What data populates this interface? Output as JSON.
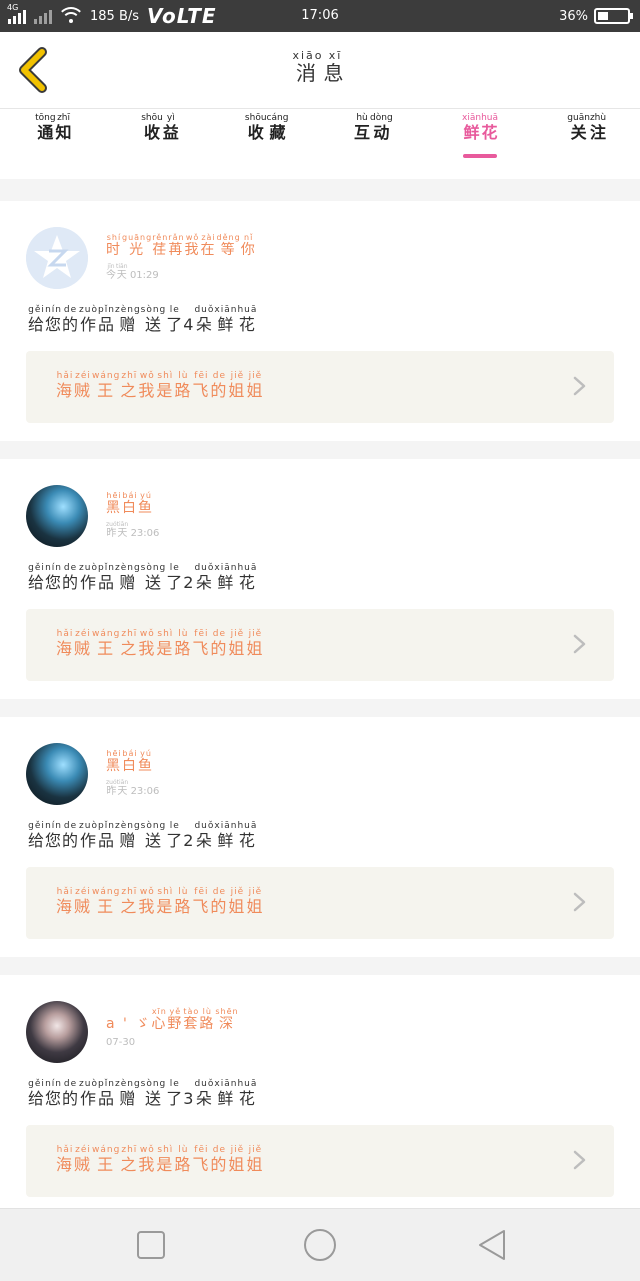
{
  "status_bar": {
    "network_label": "4G",
    "speed": "185 B/s",
    "volte": "VoLTE",
    "time": "17:06",
    "battery": "36%",
    "battery_level": 0.36
  },
  "header": {
    "title_pinyin": [
      "xiāo",
      "xī"
    ],
    "title_chars": [
      "消",
      "息"
    ]
  },
  "tabs": [
    {
      "chars": [
        "通",
        "知"
      ],
      "pinyin": [
        "tōng",
        "zhī"
      ],
      "active": false
    },
    {
      "chars": [
        "收",
        "益"
      ],
      "pinyin": [
        "shōu",
        "yì"
      ],
      "active": false
    },
    {
      "chars": [
        "收",
        "藏"
      ],
      "pinyin": [
        "shōu",
        "cáng"
      ],
      "active": false
    },
    {
      "chars": [
        "互",
        "动"
      ],
      "pinyin": [
        "hù",
        "dòng"
      ],
      "active": false
    },
    {
      "chars": [
        "鲜",
        "花"
      ],
      "pinyin": [
        "xiān",
        "huā"
      ],
      "active": true
    },
    {
      "chars": [
        "关",
        "注"
      ],
      "pinyin": [
        "guān",
        "zhù"
      ],
      "active": false
    }
  ],
  "notifications": [
    {
      "user": {
        "chars": [
          "时",
          "光",
          "荏",
          "苒",
          "我",
          "在",
          "等",
          "你"
        ],
        "pinyin": [
          "shí",
          "guāng",
          "rěn",
          "rǎn",
          "wǒ",
          "zài",
          "děng",
          "nǐ"
        ],
        "prefix": ""
      },
      "time": {
        "chars": [
          "今",
          "天"
        ],
        "pinyin": [
          "jīn",
          "tiān"
        ],
        "value": "01:29"
      },
      "avatar": "default",
      "message": {
        "chars": [
          "给",
          "您",
          "的",
          "作",
          "品",
          "赠",
          "送",
          "了",
          "4",
          "朵",
          "鲜",
          "花"
        ],
        "pinyin": [
          "gěi",
          "nín",
          "de",
          "zuò",
          "pǐn",
          "zèng",
          "sòng",
          "le",
          "",
          "duǒ",
          "xiān",
          "huā"
        ]
      },
      "work": {
        "chars": [
          "海",
          "贼",
          "王",
          "之",
          "我",
          "是",
          "路",
          "飞",
          "的",
          "姐",
          "姐"
        ],
        "pinyin": [
          "hǎi",
          "zéi",
          "wáng",
          "zhī",
          "wǒ",
          "shì",
          "lù",
          "fēi",
          "de",
          "jiě",
          "jiě"
        ]
      }
    },
    {
      "user": {
        "chars": [
          "黑",
          "白",
          "鱼"
        ],
        "pinyin": [
          "hēi",
          "bái",
          "yú"
        ],
        "prefix": ""
      },
      "time": {
        "chars": [
          "昨",
          "天"
        ],
        "pinyin": [
          "zuó",
          "tiān"
        ],
        "value": "23:06"
      },
      "avatar": "photo1",
      "message": {
        "chars": [
          "给",
          "您",
          "的",
          "作",
          "品",
          "赠",
          "送",
          "了",
          "2",
          "朵",
          "鲜",
          "花"
        ],
        "pinyin": [
          "gěi",
          "nín",
          "de",
          "zuò",
          "pǐn",
          "zèng",
          "sòng",
          "le",
          "",
          "duǒ",
          "xiān",
          "huā"
        ]
      },
      "work": {
        "chars": [
          "海",
          "贼",
          "王",
          "之",
          "我",
          "是",
          "路",
          "飞",
          "的",
          "姐",
          "姐"
        ],
        "pinyin": [
          "hǎi",
          "zéi",
          "wáng",
          "zhī",
          "wǒ",
          "shì",
          "lù",
          "fēi",
          "de",
          "jiě",
          "jiě"
        ]
      }
    },
    {
      "user": {
        "chars": [
          "黑",
          "白",
          "鱼"
        ],
        "pinyin": [
          "hēi",
          "bái",
          "yú"
        ],
        "prefix": ""
      },
      "time": {
        "chars": [
          "昨",
          "天"
        ],
        "pinyin": [
          "zuó",
          "tiān"
        ],
        "value": "23:06"
      },
      "avatar": "photo1",
      "message": {
        "chars": [
          "给",
          "您",
          "的",
          "作",
          "品",
          "赠",
          "送",
          "了",
          "2",
          "朵",
          "鲜",
          "花"
        ],
        "pinyin": [
          "gěi",
          "nín",
          "de",
          "zuò",
          "pǐn",
          "zèng",
          "sòng",
          "le",
          "",
          "duǒ",
          "xiān",
          "huā"
        ]
      },
      "work": {
        "chars": [
          "海",
          "贼",
          "王",
          "之",
          "我",
          "是",
          "路",
          "飞",
          "的",
          "姐",
          "姐"
        ],
        "pinyin": [
          "hǎi",
          "zéi",
          "wáng",
          "zhī",
          "wǒ",
          "shì",
          "lù",
          "fēi",
          "de",
          "jiě",
          "jiě"
        ]
      }
    },
    {
      "user": {
        "chars": [
          "心",
          "野",
          "套",
          "路",
          "深"
        ],
        "pinyin": [
          "xīn",
          "yě",
          "tào",
          "lù",
          "shēn"
        ],
        "prefix": "a ' ゞ"
      },
      "time": {
        "chars": [],
        "pinyin": [],
        "value": "07-30"
      },
      "avatar": "photo2",
      "message": {
        "chars": [
          "给",
          "您",
          "的",
          "作",
          "品",
          "赠",
          "送",
          "了",
          "3",
          "朵",
          "鲜",
          "花"
        ],
        "pinyin": [
          "gěi",
          "nín",
          "de",
          "zuò",
          "pǐn",
          "zèng",
          "sòng",
          "le",
          "",
          "duǒ",
          "xiān",
          "huā"
        ]
      },
      "work": {
        "chars": [
          "海",
          "贼",
          "王",
          "之",
          "我",
          "是",
          "路",
          "飞",
          "的",
          "姐",
          "姐"
        ],
        "pinyin": [
          "hǎi",
          "zéi",
          "wáng",
          "zhī",
          "wǒ",
          "shì",
          "lù",
          "fēi",
          "de",
          "jiě",
          "jiě"
        ]
      }
    }
  ],
  "nav_bar": {
    "icons": [
      "recent-apps-icon",
      "home-icon",
      "back-icon"
    ]
  },
  "colors": {
    "accent_pink": "#e85a9c",
    "name_orange": "#f08b5b",
    "back_arrow_yellow": "#f2c200"
  }
}
